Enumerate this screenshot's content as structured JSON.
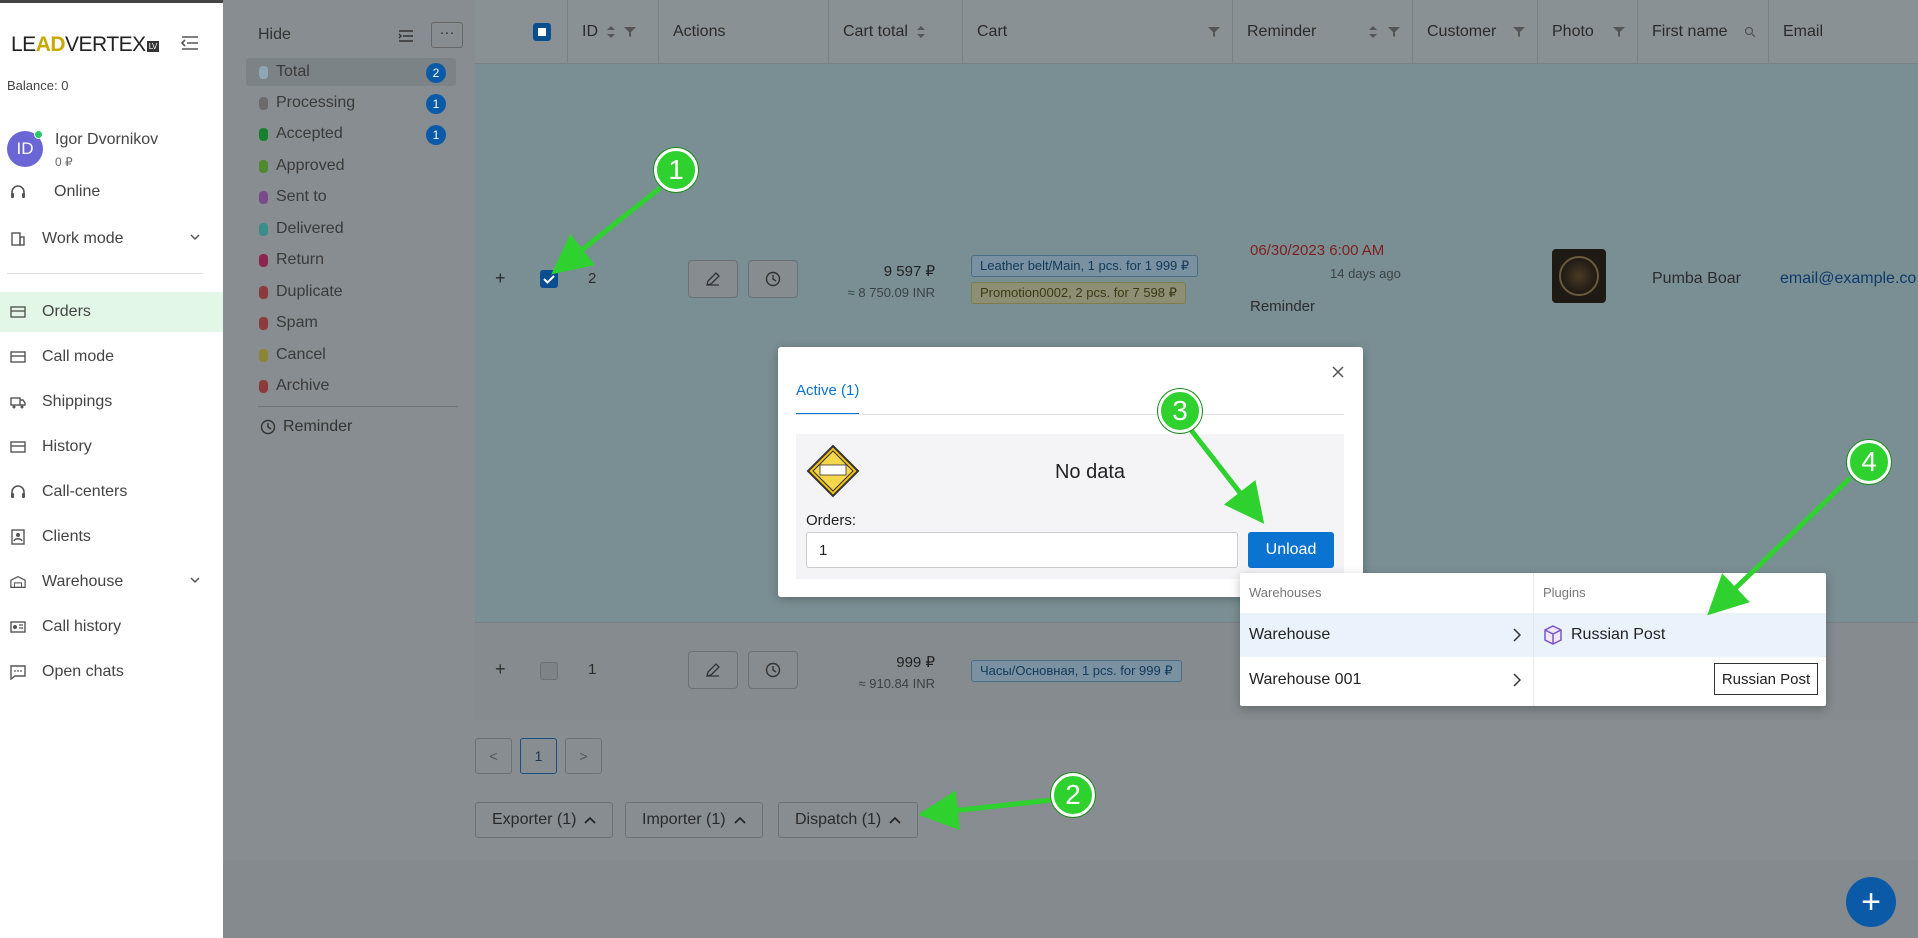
{
  "brand": {
    "logo_pre": "LE",
    "logo_ad": "AD",
    "logo_post": "VERTEX",
    "logo_tag": "LV"
  },
  "sidebar": {
    "balance": "Balance:  0",
    "user_initials": "ID",
    "user_name": "Igor Dvornikov",
    "user_balance": "0 ₽",
    "online": "Online",
    "work_mode": "Work mode",
    "items": [
      {
        "label": "Orders",
        "icon": "orders-icon"
      },
      {
        "label": "Call mode",
        "icon": "call-mode-icon"
      },
      {
        "label": "Shippings",
        "icon": "truck-icon"
      },
      {
        "label": "History",
        "icon": "history-icon"
      },
      {
        "label": "Call-centers",
        "icon": "headset-icon"
      },
      {
        "label": "Clients",
        "icon": "clients-icon"
      },
      {
        "label": "Warehouse",
        "icon": "warehouse-icon"
      },
      {
        "label": "Call history",
        "icon": "call-history-icon"
      },
      {
        "label": "Open chats",
        "icon": "chat-icon"
      }
    ]
  },
  "status_panel": {
    "hide_label": "Hide",
    "more": "···",
    "statuses": [
      {
        "label": "Total",
        "color": "#8fa7b3",
        "count": "2"
      },
      {
        "label": "Processing",
        "color": "#6b6b6b",
        "count": "1"
      },
      {
        "label": "Accepted",
        "color": "#17802e",
        "count": "1"
      },
      {
        "label": "Approved",
        "color": "#4f8a2e",
        "count": ""
      },
      {
        "label": "Sent to",
        "color": "#7a4a8c",
        "count": ""
      },
      {
        "label": "Delivered",
        "color": "#3c8c8c",
        "count": ""
      },
      {
        "label": "Return",
        "color": "#8c2450",
        "count": ""
      },
      {
        "label": "Duplicate",
        "color": "#8c3a3a",
        "count": ""
      },
      {
        "label": "Spam",
        "color": "#8c3a3a",
        "count": ""
      },
      {
        "label": "Cancel",
        "color": "#8c8433",
        "count": ""
      },
      {
        "label": "Archive",
        "color": "#8c3a3a",
        "count": ""
      }
    ],
    "reminder": "Reminder"
  },
  "table": {
    "columns": {
      "id": "ID",
      "actions": "Actions",
      "cart_total": "Cart total",
      "cart": "Cart",
      "reminder": "Reminder",
      "customer": "Customer",
      "photo": "Photo",
      "first_name": "First name",
      "email": "Email"
    },
    "rows": [
      {
        "plus": "+",
        "id": "2",
        "total": "9 597 ₽",
        "total_sub": "≈ 8 750.09 INR",
        "cart": [
          "Leather belt/Main, 1 pcs. for 1 999 ₽",
          "Promotion0002, 2 pcs. for 7 598 ₽"
        ],
        "reminder_date": "06/30/2023 6:00 AM",
        "reminder_ago": "14 days ago",
        "reminder_label": "Reminder",
        "first_name": "Pumba Boar",
        "email": "email@example.co"
      },
      {
        "plus": "+",
        "id": "1",
        "total": "999 ₽",
        "total_sub": "≈ 910.84 INR",
        "cart": [
          "Часы/Основная, 1 pcs. for 999 ₽"
        ]
      }
    ],
    "page": "1",
    "prev": "<",
    "next": ">"
  },
  "bottom_buttons": {
    "exporter": "Exporter (1)",
    "importer": "Importer (1)",
    "dispatch": "Dispatch (1)"
  },
  "fab": "+",
  "modal": {
    "tab": "Active (1)",
    "no_data": "No data",
    "orders_label": "Orders:",
    "orders_value": "1",
    "unload": "Unload"
  },
  "dropdown": {
    "warehouses_head": "Warehouses",
    "plugins_head": "Plugins",
    "warehouses": [
      "Warehouse",
      "Warehouse 001"
    ],
    "plugin": "Russian Post",
    "tooltip": "Russian Post"
  },
  "callouts": [
    "1",
    "2",
    "3",
    "4"
  ],
  "colors": {
    "accent": "#0b73d0",
    "callout": "#2ed12e",
    "active_nav": "#e3f7e7"
  }
}
